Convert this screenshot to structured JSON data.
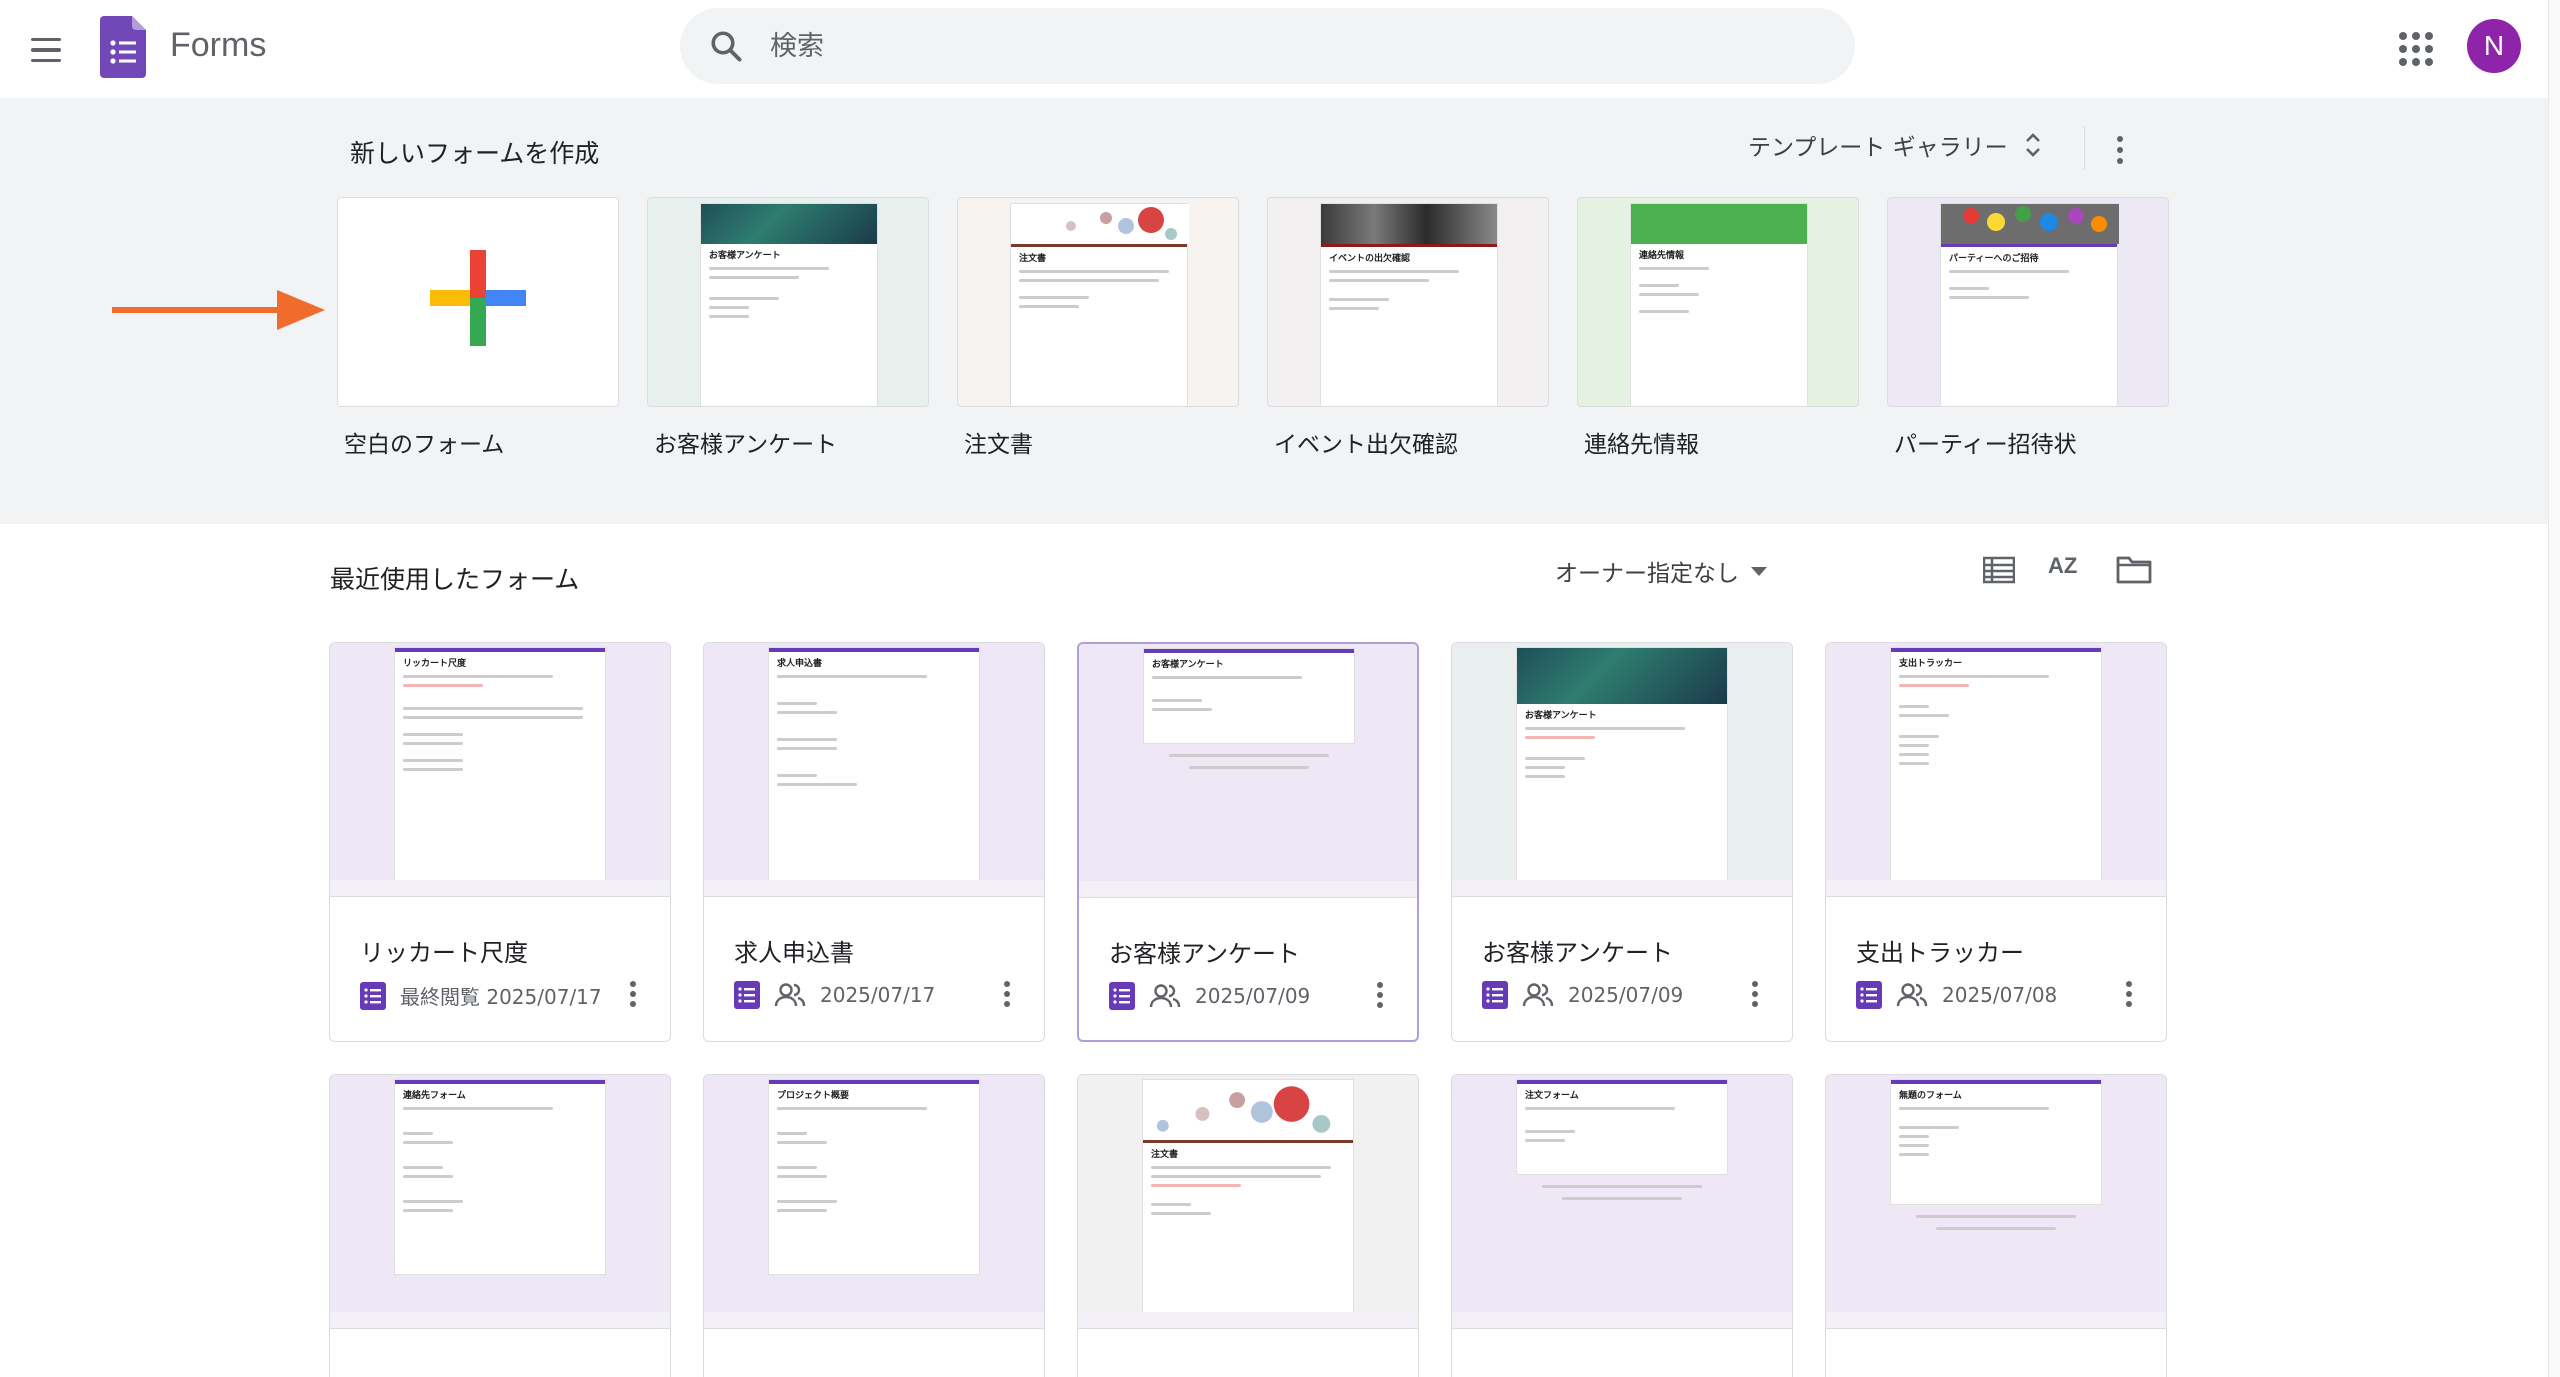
{
  "header": {
    "app_title": "Forms",
    "search_placeholder": "検索",
    "avatar_initial": "N"
  },
  "templates": {
    "section_title": "新しいフォームを作成",
    "gallery_label": "テンプレート ギャラリー",
    "items": [
      {
        "label": "空白のフォーム"
      },
      {
        "label": "お客様アンケート"
      },
      {
        "label": "注文書"
      },
      {
        "label": "イベント出欠確認"
      },
      {
        "label": "連絡先情報"
      },
      {
        "label": "パーティー招待状"
      }
    ]
  },
  "recent": {
    "title": "最近使用したフォーム",
    "owner_filter": "オーナー指定なし",
    "sort_label": "AZ",
    "row1": [
      {
        "name": "リッカート尺度",
        "meta": "最終閲覧 2025/07/17",
        "preview_title": "リッカート尺度"
      },
      {
        "name": "求人申込書",
        "meta": "2025/07/17",
        "preview_title": "求人申込書"
      },
      {
        "name": "お客様アンケート",
        "meta": "2025/07/09",
        "preview_title": "お客様アンケート"
      },
      {
        "name": "お客様アンケート",
        "meta": "2025/07/09",
        "preview_title": "お客様アンケート"
      },
      {
        "name": "支出トラッカー",
        "meta": "2025/07/08",
        "preview_title": "支出トラッカー"
      }
    ],
    "row2": [
      {
        "preview_title": "連絡先フォーム"
      },
      {
        "preview_title": "プロジェクト概要"
      },
      {
        "preview_title": "注文書"
      },
      {
        "preview_title": "注文フォーム"
      },
      {
        "preview_title": "無題のフォーム"
      }
    ]
  },
  "colors": {
    "forms_purple": "#673ab7",
    "avatar": "#8e24aa",
    "arrow": "#ef6c2c",
    "template_bg": "#f1f3f4"
  }
}
